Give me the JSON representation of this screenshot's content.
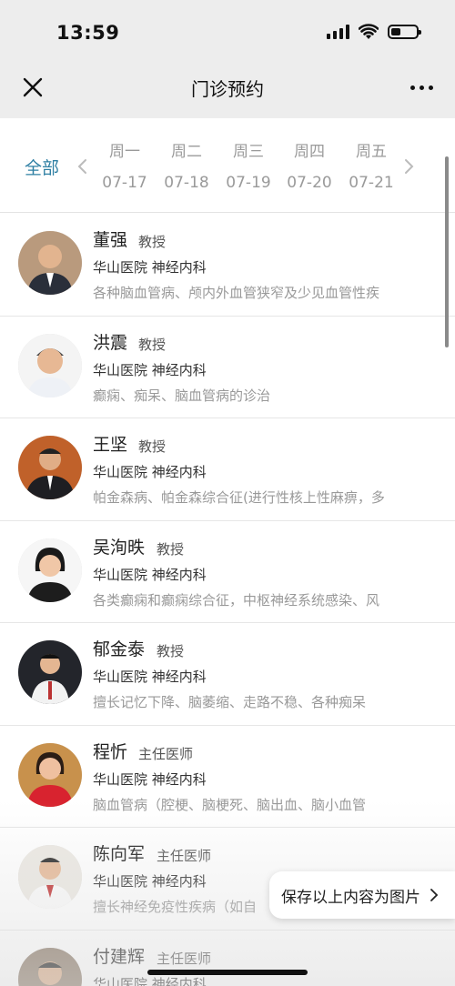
{
  "status": {
    "time": "13:59"
  },
  "nav": {
    "title": "门诊预约"
  },
  "date_bar": {
    "all_label": "全部",
    "days": [
      {
        "weekday": "周一",
        "date": "07-17"
      },
      {
        "weekday": "周二",
        "date": "07-18"
      },
      {
        "weekday": "周三",
        "date": "07-19"
      },
      {
        "weekday": "周四",
        "date": "07-20"
      },
      {
        "weekday": "周五",
        "date": "07-21"
      }
    ]
  },
  "doctors": [
    {
      "name": "董强",
      "title": "教授",
      "hospital": "华山医院 神经内科",
      "specialty": "各种脑血管病、颅内外血管狭窄及少见血管性疾"
    },
    {
      "name": "洪震",
      "title": "教授",
      "hospital": "华山医院 神经内科",
      "specialty": "癫痫、痴呆、脑血管病的诊治"
    },
    {
      "name": "王坚",
      "title": "教授",
      "hospital": "华山医院 神经内科",
      "specialty": "帕金森病、帕金森综合征(进行性核上性麻痹，多"
    },
    {
      "name": "吴洵昳",
      "title": "教授",
      "hospital": "华山医院 神经内科",
      "specialty": "各类癫痫和癫痫综合征，中枢神经系统感染、风"
    },
    {
      "name": "郁金泰",
      "title": "教授",
      "hospital": "华山医院 神经内科",
      "specialty": "擅长记忆下降、脑萎缩、走路不稳、各种痴呆"
    },
    {
      "name": "程忻",
      "title": "主任医师",
      "hospital": "华山医院 神经内科",
      "specialty": "脑血管病（腔梗、脑梗死、脑出血、脑小血管"
    },
    {
      "name": "陈向军",
      "title": "主任医师",
      "hospital": "华山医院 神经内科",
      "specialty": "擅长神经免疫性疾病（如自"
    },
    {
      "name": "付建辉",
      "title": "主任医师",
      "hospital": "华山医院 神经内科",
      "specialty": ""
    }
  ],
  "save_chip": {
    "label": "保存以上内容为图片"
  },
  "colors": {
    "accent": "#2e7fa3",
    "muted": "#999999"
  }
}
